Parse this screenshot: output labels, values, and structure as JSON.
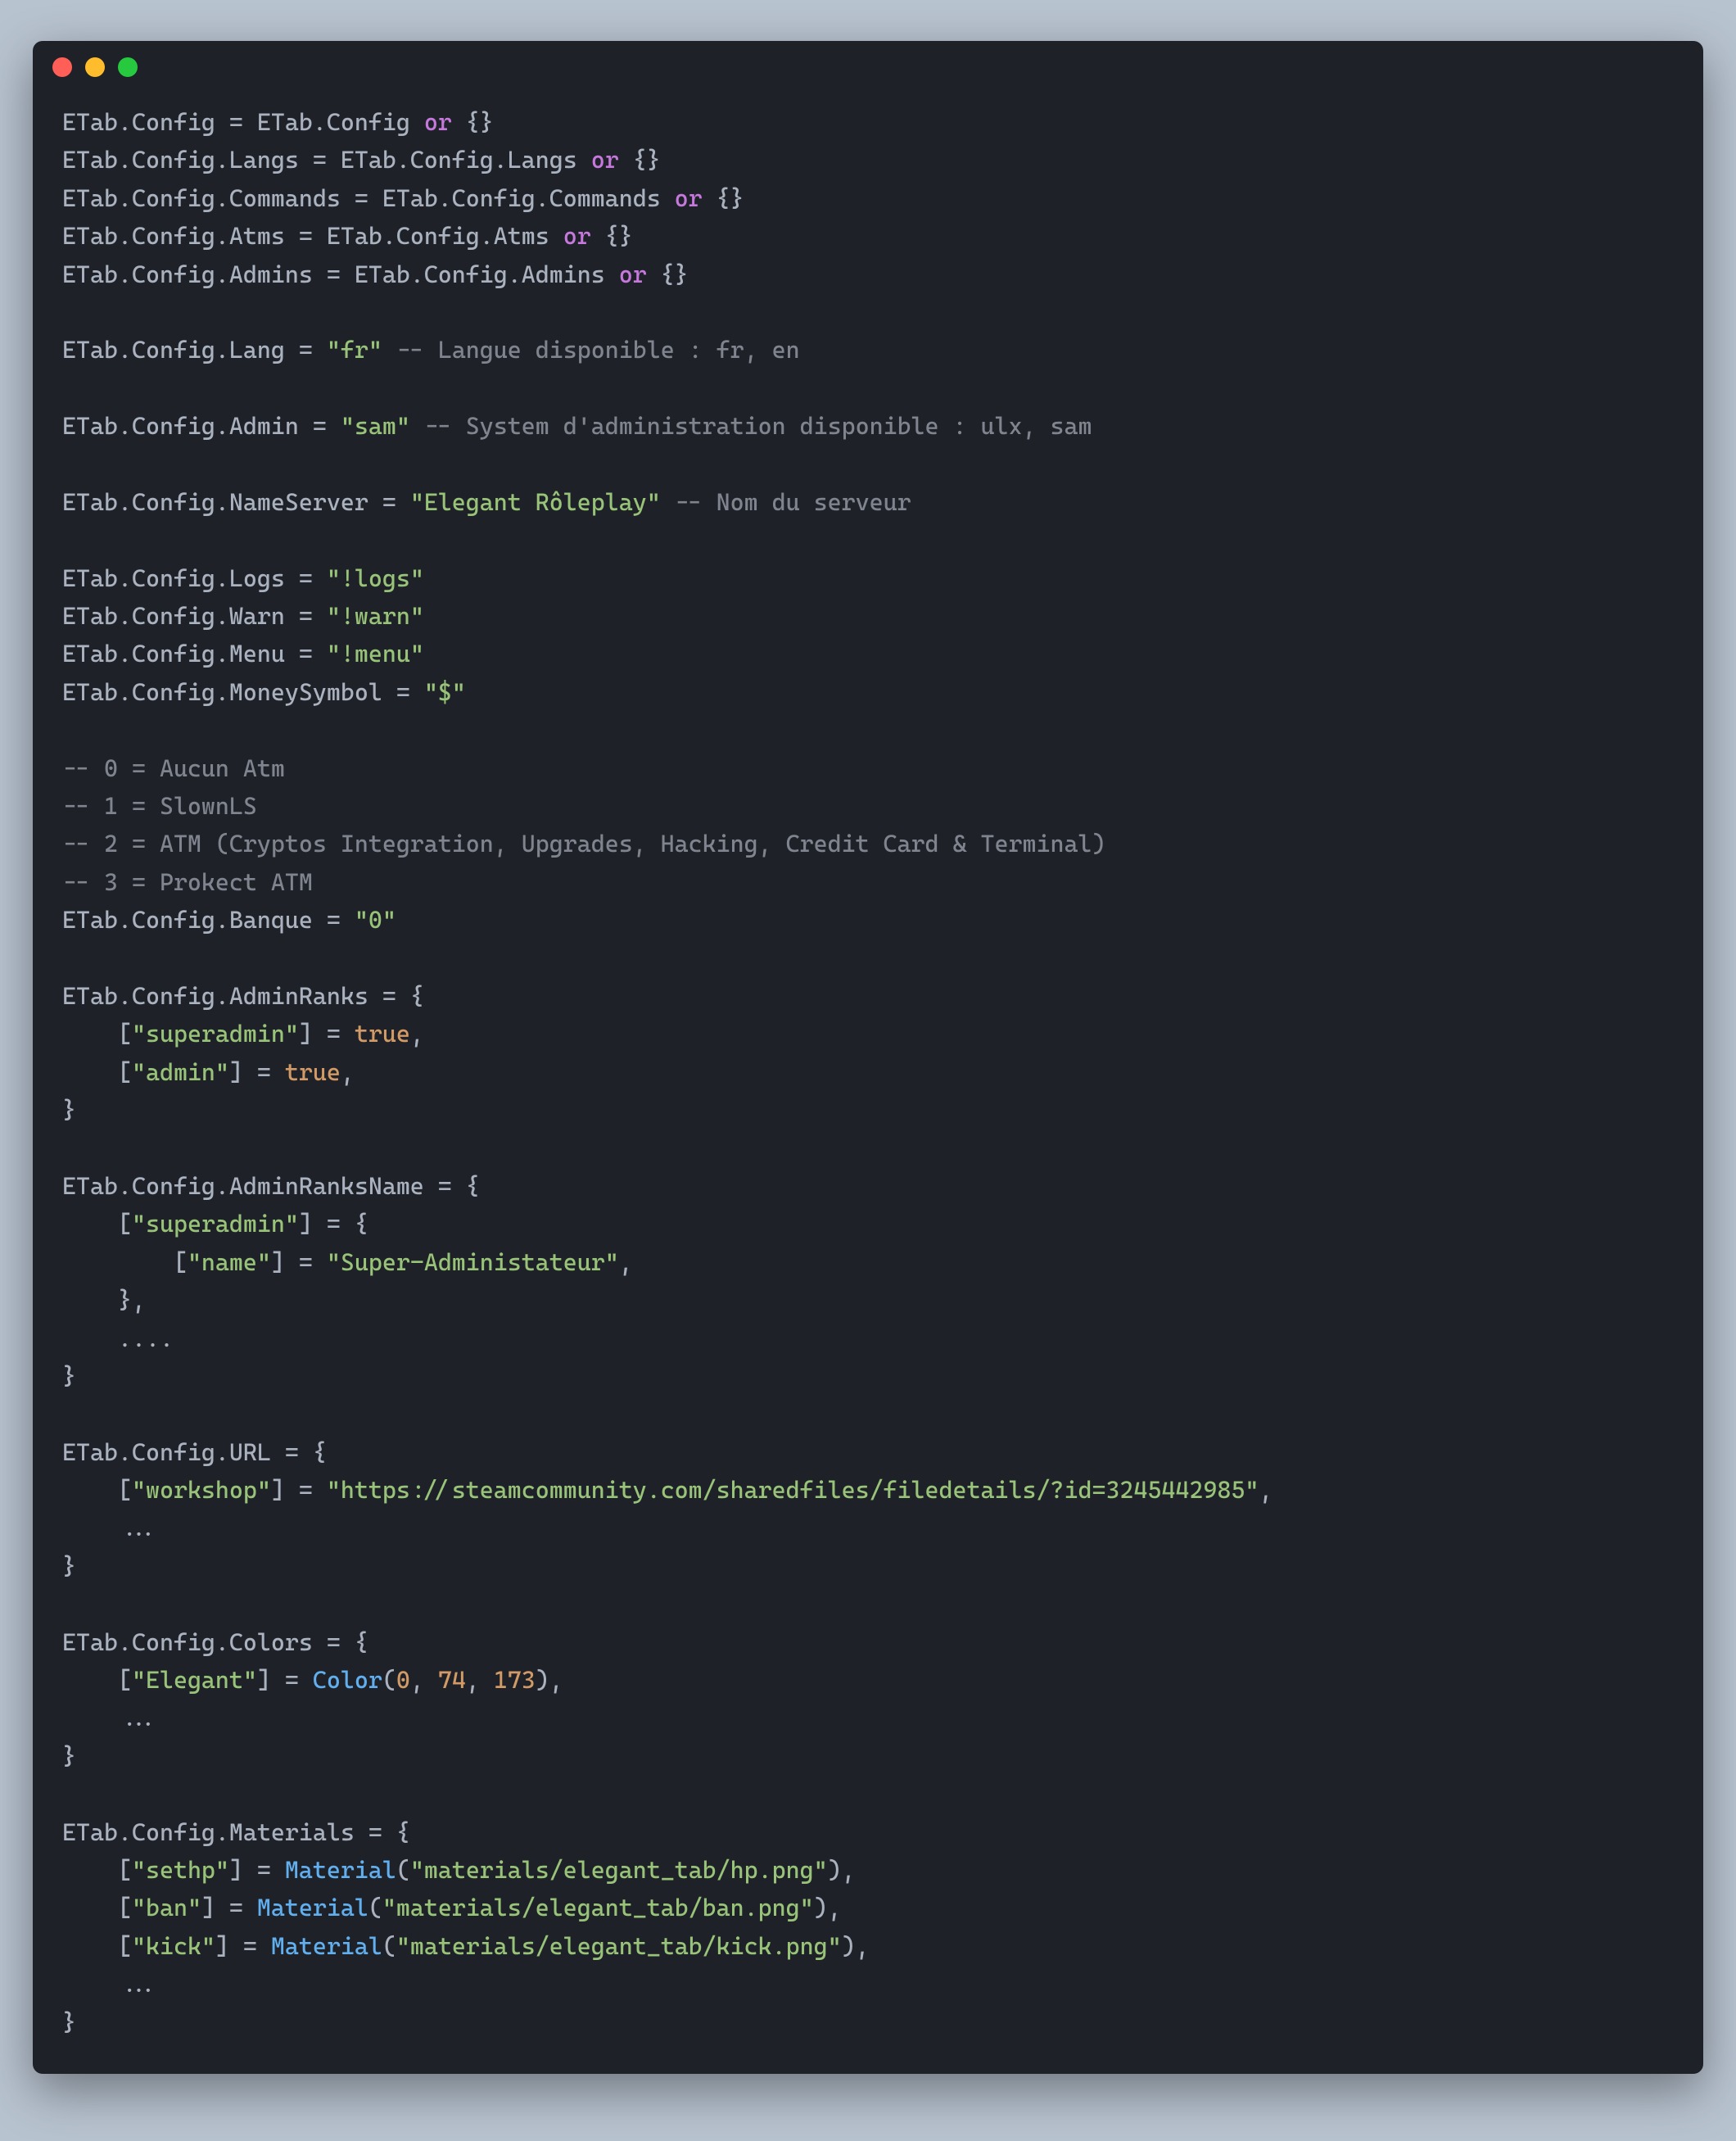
{
  "window": {
    "controls": [
      "close",
      "minimize",
      "zoom"
    ]
  },
  "tokens": [
    [
      [
        "ETab.Config ",
        "t-default"
      ],
      [
        "=",
        "t-default"
      ],
      [
        " ETab.Config ",
        "t-default"
      ],
      [
        "or",
        "t-key"
      ],
      [
        " {}",
        "t-default"
      ]
    ],
    [
      [
        "ETab.Config.Langs ",
        "t-default"
      ],
      [
        "=",
        "t-default"
      ],
      [
        " ETab.Config.Langs ",
        "t-default"
      ],
      [
        "or",
        "t-key"
      ],
      [
        " {}",
        "t-default"
      ]
    ],
    [
      [
        "ETab.Config.Commands ",
        "t-default"
      ],
      [
        "=",
        "t-default"
      ],
      [
        " ETab.Config.Commands ",
        "t-default"
      ],
      [
        "or",
        "t-key"
      ],
      [
        " {}",
        "t-default"
      ]
    ],
    [
      [
        "ETab.Config.Atms ",
        "t-default"
      ],
      [
        "=",
        "t-default"
      ],
      [
        " ETab.Config.Atms ",
        "t-default"
      ],
      [
        "or",
        "t-key"
      ],
      [
        " {}",
        "t-default"
      ]
    ],
    [
      [
        "ETab.Config.Admins ",
        "t-default"
      ],
      [
        "=",
        "t-default"
      ],
      [
        " ETab.Config.Admins ",
        "t-default"
      ],
      [
        "or",
        "t-key"
      ],
      [
        " {}",
        "t-default"
      ]
    ],
    [],
    [
      [
        "ETab.Config.Lang ",
        "t-default"
      ],
      [
        "=",
        "t-default"
      ],
      [
        " ",
        "t-default"
      ],
      [
        "\"fr\"",
        "t-str"
      ],
      [
        " ",
        "t-default"
      ],
      [
        "-- Langue disponible : fr, en",
        "t-comment"
      ]
    ],
    [],
    [
      [
        "ETab.Config.Admin ",
        "t-default"
      ],
      [
        "=",
        "t-default"
      ],
      [
        " ",
        "t-default"
      ],
      [
        "\"sam\"",
        "t-str"
      ],
      [
        " ",
        "t-default"
      ],
      [
        "-- System d'administration disponible : ulx, sam",
        "t-comment"
      ]
    ],
    [],
    [
      [
        "ETab.Config.NameServer ",
        "t-default"
      ],
      [
        "=",
        "t-default"
      ],
      [
        " ",
        "t-default"
      ],
      [
        "\"Elegant Rôleplay\"",
        "t-str"
      ],
      [
        " ",
        "t-default"
      ],
      [
        "-- Nom du serveur",
        "t-comment"
      ]
    ],
    [],
    [
      [
        "ETab.Config.Logs ",
        "t-default"
      ],
      [
        "=",
        "t-default"
      ],
      [
        " ",
        "t-default"
      ],
      [
        "\"!logs\"",
        "t-str"
      ]
    ],
    [
      [
        "ETab.Config.Warn ",
        "t-default"
      ],
      [
        "=",
        "t-default"
      ],
      [
        " ",
        "t-default"
      ],
      [
        "\"!warn\"",
        "t-str"
      ]
    ],
    [
      [
        "ETab.Config.Menu ",
        "t-default"
      ],
      [
        "=",
        "t-default"
      ],
      [
        " ",
        "t-default"
      ],
      [
        "\"!menu\"",
        "t-str"
      ]
    ],
    [
      [
        "ETab.Config.MoneySymbol ",
        "t-default"
      ],
      [
        "=",
        "t-default"
      ],
      [
        " ",
        "t-default"
      ],
      [
        "\"$\"",
        "t-str"
      ]
    ],
    [],
    [
      [
        "-- 0 = Aucun Atm",
        "t-comment"
      ]
    ],
    [
      [
        "-- 1 = SlownLS",
        "t-comment"
      ]
    ],
    [
      [
        "-- 2 = ATM (Cryptos Integration, Upgrades, Hacking, Credit Card & Terminal)",
        "t-comment"
      ]
    ],
    [
      [
        "-- 3 = Prokect ATM",
        "t-comment"
      ]
    ],
    [
      [
        "ETab.Config.Banque ",
        "t-default"
      ],
      [
        "=",
        "t-default"
      ],
      [
        " ",
        "t-default"
      ],
      [
        "\"0\"",
        "t-str"
      ]
    ],
    [],
    [
      [
        "ETab.Config.AdminRanks ",
        "t-default"
      ],
      [
        "=",
        "t-default"
      ],
      [
        " {",
        "t-default"
      ]
    ],
    [
      [
        "    [",
        "t-default"
      ],
      [
        "\"superadmin\"",
        "t-str"
      ],
      [
        "] ",
        "t-default"
      ],
      [
        "=",
        "t-default"
      ],
      [
        " ",
        "t-default"
      ],
      [
        "true",
        "t-bool"
      ],
      [
        ",",
        "t-default"
      ]
    ],
    [
      [
        "    [",
        "t-default"
      ],
      [
        "\"admin\"",
        "t-str"
      ],
      [
        "] ",
        "t-default"
      ],
      [
        "=",
        "t-default"
      ],
      [
        " ",
        "t-default"
      ],
      [
        "true",
        "t-bool"
      ],
      [
        ",",
        "t-default"
      ]
    ],
    [
      [
        "}",
        "t-default"
      ]
    ],
    [],
    [
      [
        "ETab.Config.AdminRanksName ",
        "t-default"
      ],
      [
        "=",
        "t-default"
      ],
      [
        " {",
        "t-default"
      ]
    ],
    [
      [
        "    [",
        "t-default"
      ],
      [
        "\"superadmin\"",
        "t-str"
      ],
      [
        "] ",
        "t-default"
      ],
      [
        "=",
        "t-default"
      ],
      [
        " {",
        "t-default"
      ]
    ],
    [
      [
        "        [",
        "t-default"
      ],
      [
        "\"name\"",
        "t-str"
      ],
      [
        "] ",
        "t-default"
      ],
      [
        "=",
        "t-default"
      ],
      [
        " ",
        "t-default"
      ],
      [
        "\"Super-Administateur\"",
        "t-str"
      ],
      [
        ",",
        "t-default"
      ]
    ],
    [
      [
        "    },",
        "t-default"
      ]
    ],
    [
      [
        "    ....",
        "t-default"
      ]
    ],
    [
      [
        "}",
        "t-default"
      ]
    ],
    [],
    [
      [
        "ETab.Config.URL ",
        "t-default"
      ],
      [
        "=",
        "t-default"
      ],
      [
        " {",
        "t-default"
      ]
    ],
    [
      [
        "    [",
        "t-default"
      ],
      [
        "\"workshop\"",
        "t-str"
      ],
      [
        "] ",
        "t-default"
      ],
      [
        "=",
        "t-default"
      ],
      [
        " ",
        "t-default"
      ],
      [
        "\"https://steamcommunity.com/sharedfiles/filedetails/?id=3245442985\"",
        "t-str"
      ],
      [
        ",",
        "t-default"
      ]
    ],
    [
      [
        "    ...",
        "t-default"
      ]
    ],
    [
      [
        "}",
        "t-default"
      ]
    ],
    [],
    [
      [
        "ETab.Config.Colors ",
        "t-default"
      ],
      [
        "=",
        "t-default"
      ],
      [
        " {",
        "t-default"
      ]
    ],
    [
      [
        "    [",
        "t-default"
      ],
      [
        "\"Elegant\"",
        "t-str"
      ],
      [
        "] ",
        "t-default"
      ],
      [
        "=",
        "t-default"
      ],
      [
        " ",
        "t-default"
      ],
      [
        "Color",
        "t-func"
      ],
      [
        "(",
        "t-default"
      ],
      [
        "0",
        "t-num"
      ],
      [
        ", ",
        "t-default"
      ],
      [
        "74",
        "t-num"
      ],
      [
        ", ",
        "t-default"
      ],
      [
        "173",
        "t-num"
      ],
      [
        "),",
        "t-default"
      ]
    ],
    [
      [
        "    ...",
        "t-default"
      ]
    ],
    [
      [
        "}",
        "t-default"
      ]
    ],
    [],
    [
      [
        "ETab.Config.Materials ",
        "t-default"
      ],
      [
        "=",
        "t-default"
      ],
      [
        " {",
        "t-default"
      ]
    ],
    [
      [
        "    [",
        "t-default"
      ],
      [
        "\"sethp\"",
        "t-str"
      ],
      [
        "] ",
        "t-default"
      ],
      [
        "=",
        "t-default"
      ],
      [
        " ",
        "t-default"
      ],
      [
        "Material",
        "t-func"
      ],
      [
        "(",
        "t-default"
      ],
      [
        "\"materials/elegant_tab/hp.png\"",
        "t-str"
      ],
      [
        "),",
        "t-default"
      ]
    ],
    [
      [
        "    [",
        "t-default"
      ],
      [
        "\"ban\"",
        "t-str"
      ],
      [
        "] ",
        "t-default"
      ],
      [
        "=",
        "t-default"
      ],
      [
        " ",
        "t-default"
      ],
      [
        "Material",
        "t-func"
      ],
      [
        "(",
        "t-default"
      ],
      [
        "\"materials/elegant_tab/ban.png\"",
        "t-str"
      ],
      [
        "),",
        "t-default"
      ]
    ],
    [
      [
        "    [",
        "t-default"
      ],
      [
        "\"kick\"",
        "t-str"
      ],
      [
        "] ",
        "t-default"
      ],
      [
        "=",
        "t-default"
      ],
      [
        " ",
        "t-default"
      ],
      [
        "Material",
        "t-func"
      ],
      [
        "(",
        "t-default"
      ],
      [
        "\"materials/elegant_tab/kick.png\"",
        "t-str"
      ],
      [
        "),",
        "t-default"
      ]
    ],
    [
      [
        "    ...",
        "t-default"
      ]
    ],
    [
      [
        "}",
        "t-default"
      ]
    ]
  ]
}
